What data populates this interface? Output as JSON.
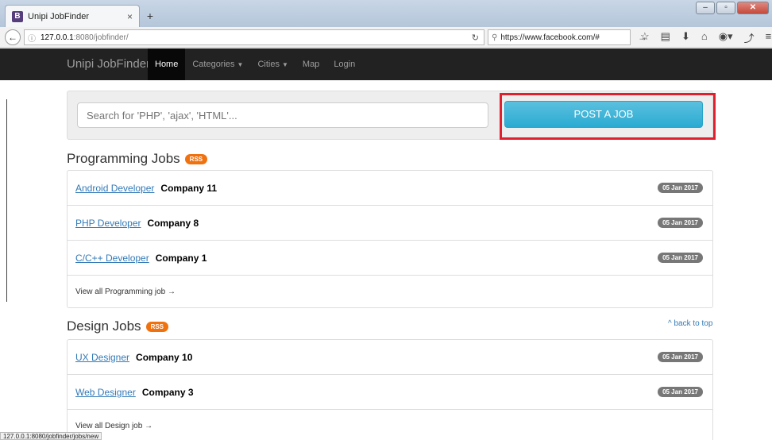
{
  "browser": {
    "tab_title": "Unipi JobFinder",
    "tab_favicon": "B",
    "tab_close": "×",
    "new_tab": "+",
    "url_host": "127.0.0.1",
    "url_path": ":8080/jobfinder/",
    "search_value": "https://www.facebook.com/#",
    "status_url": "127.0.0.1:8080/jobfinder/jobs/new"
  },
  "nav": {
    "brand": "Unipi JobFinder",
    "items": [
      {
        "label": "Home",
        "active": true
      },
      {
        "label": "Categories",
        "dropdown": true
      },
      {
        "label": "Cities",
        "dropdown": true
      },
      {
        "label": "Map"
      },
      {
        "label": "Login"
      }
    ]
  },
  "search": {
    "placeholder": "Search for 'PHP', 'ajax', 'HTML'..."
  },
  "post_job_label": "POST A JOB",
  "rss_label": "RSS",
  "back_to_top": "^ back to top",
  "sections": [
    {
      "title": "Programming Jobs",
      "jobs": [
        {
          "title": "Android Developer",
          "company": "Company 11",
          "date": "05 Jan 2017"
        },
        {
          "title": "PHP Developer",
          "company": "Company 8",
          "date": "05 Jan 2017"
        },
        {
          "title": "C/C++ Developer",
          "company": "Company 1",
          "date": "05 Jan 2017"
        }
      ],
      "view_all": "View all Programming job →"
    },
    {
      "title": "Design Jobs",
      "jobs": [
        {
          "title": "UX Designer",
          "company": "Company 10",
          "date": "05 Jan 2017"
        },
        {
          "title": "Web Designer",
          "company": "Company 3",
          "date": "05 Jan 2017"
        }
      ],
      "view_all": "View all Design job →"
    }
  ],
  "colors": {
    "accent": "#5bc0de",
    "highlight": "#e0202f",
    "rss": "#f0720f",
    "navbar": "#222222"
  }
}
